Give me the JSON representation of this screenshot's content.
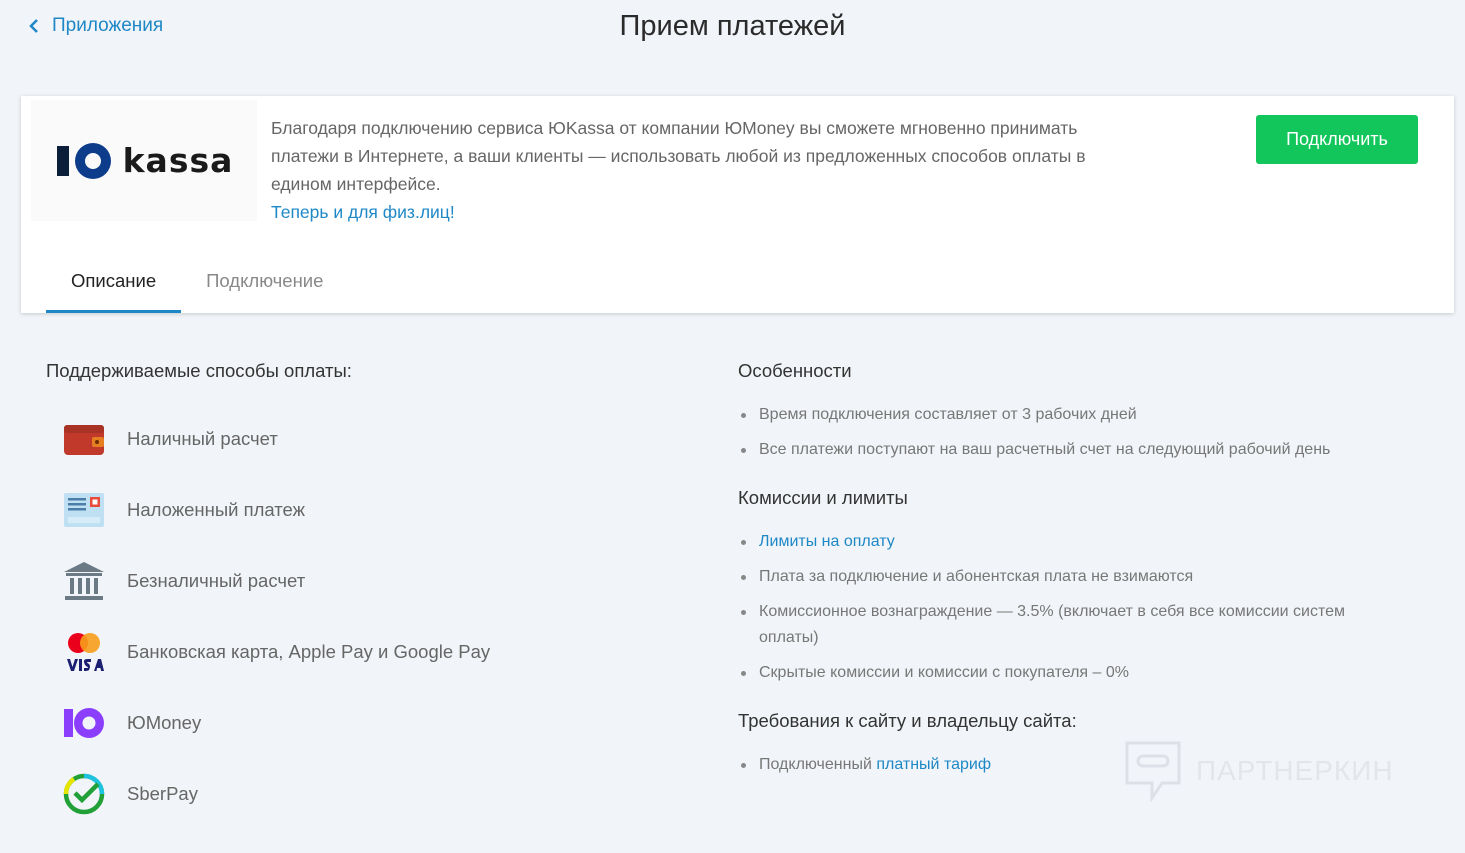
{
  "header": {
    "back_label": "Приложения",
    "title": "Прием платежей"
  },
  "app_card": {
    "logo_word": "kassa",
    "description": "Благодаря подключению сервиса ЮKassa от компании ЮMoney вы сможете мгновенно принимать платежи в Интернете, а ваши клиенты — использовать любой из предложенных способов оплаты в едином интерфейсе.",
    "promo_link": "Теперь и для физ.лиц!",
    "connect_button": "Подключить",
    "tabs": [
      {
        "label": "Описание",
        "active": true
      },
      {
        "label": "Подключение",
        "active": false
      }
    ]
  },
  "payment_methods": {
    "heading": "Поддерживаемые способы оплаты:",
    "items": [
      {
        "label": "Наличный расчет",
        "icon": "wallet-icon"
      },
      {
        "label": "Наложенный платеж",
        "icon": "cod-invoice-icon"
      },
      {
        "label": "Безналичный расчет",
        "icon": "bank-icon"
      },
      {
        "label": "Банковская карта, Apple Pay и Google Pay",
        "icon": "mastercard-visa-icon"
      },
      {
        "label": "ЮMoney",
        "icon": "yoomoney-icon"
      },
      {
        "label": "SberPay",
        "icon": "sberpay-icon"
      }
    ]
  },
  "features": {
    "heading": "Особенности",
    "items": [
      "Время подключения составляет от 3 рабочих дней",
      "Все платежи поступают на ваш расчетный счет на следующий рабочий день"
    ]
  },
  "fees": {
    "heading": "Комиссии и лимиты",
    "link_item": "Лимиты на оплату",
    "items": [
      "Плата за подключение и абонентская плата не взимаются",
      "Комиссионное вознаграждение — 3.5% (включает в себя все комиссии систем оплаты)",
      "Скрытые комиссии и комиссии с покупателя – 0%"
    ]
  },
  "requirements": {
    "heading": "Требования к сайту и владельцу сайта:",
    "item_prefix": "Подключенный ",
    "item_link": "платный тариф"
  },
  "watermark": "ПАРТНЕРКИН",
  "colors": {
    "accent": "#1e88c7",
    "connect_button": "#13c65b",
    "background": "#f1f4f8"
  }
}
